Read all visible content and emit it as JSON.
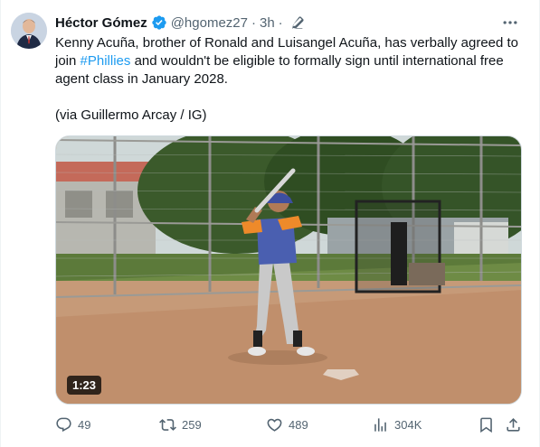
{
  "tweet": {
    "author_name": "Héctor Gómez",
    "handle": "@hgomez27",
    "separator": "·",
    "time": "3h",
    "separator2": "·",
    "text_line": "Kenny Acuña, brother of Ronald and Luisangel Acuña, has verbally agreed to join",
    "hashtag": "#Phillies",
    "text_after": "and wouldn't be eligible to formally sign until international free agent class in January 2028.",
    "credit": "(via Guillermo Arcay / IG)"
  },
  "media": {
    "duration": "1:23"
  },
  "actions": {
    "replies": "49",
    "reposts": "259",
    "likes": "489",
    "views": "304K"
  },
  "colors": {
    "accent": "#1d9bf0",
    "text": "#0f1419",
    "muted": "#536471"
  }
}
